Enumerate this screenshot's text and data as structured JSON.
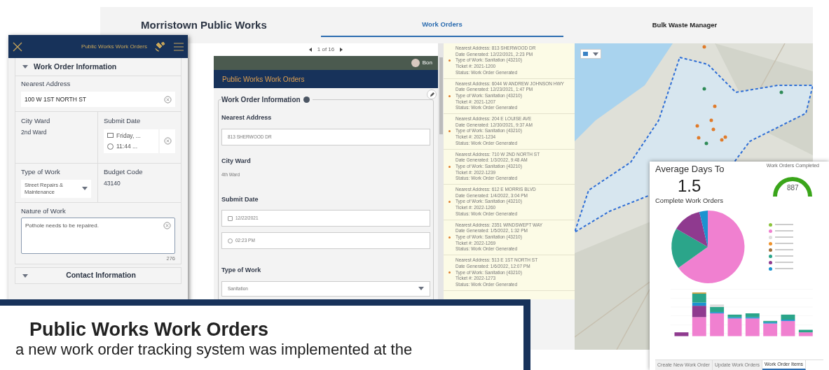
{
  "dashboard": {
    "title": "Morristown Public Works",
    "tabs": [
      {
        "label": "Work Orders",
        "selected": true
      },
      {
        "label": "Bulk Waste Manager",
        "selected": false
      }
    ]
  },
  "form_panel": {
    "pager": "1 of 16",
    "user": "Bon",
    "title": "Public Works Work Orders",
    "section": "Work Order Information",
    "fields": [
      {
        "kind": "input",
        "label": "Nearest Address",
        "values": [
          "813 SHERWOOD DR"
        ]
      },
      {
        "kind": "text",
        "label": "City Ward",
        "values": [
          "4th Ward"
        ]
      },
      {
        "kind": "date",
        "label": "Submit Date",
        "values": [
          "12/22/2021",
          "02:23 PM"
        ]
      },
      {
        "kind": "select",
        "label": "Type of Work",
        "values": [
          "Sanitation"
        ]
      }
    ]
  },
  "work_orders": [
    {
      "lines": [
        "Nearest Address: 813 SHERWOOD DR",
        "Date Generated: 12/22/2021, 2:23 PM",
        "Type of Work: Sanitation (43210)",
        "Ticket #: 2021-1200",
        "Status: Work Order Generated"
      ]
    },
    {
      "lines": [
        "Nearest Address: 6044 W ANDREW JOHNSON HWY",
        "Date Generated: 12/23/2021, 1:47 PM",
        "Type of Work: Sanitation (43210)",
        "Ticket #: 2021-1207",
        "Status: Work Order Generated"
      ]
    },
    {
      "lines": [
        "Nearest Address: 204 E LOUISE AVE",
        "Date Generated: 12/30/2021, 9:37 AM",
        "Type of Work: Sanitation (43210)",
        "Ticket #: 2021-1234",
        "Status: Work Order Generated"
      ]
    },
    {
      "lines": [
        "Nearest Address: 710 W 2ND NORTH ST",
        "Date Generated: 1/3/2022, 9:48 AM",
        "Type of Work: Sanitation (43210)",
        "Ticket #: 2022-1239",
        "Status: Work Order Generated"
      ]
    },
    {
      "lines": [
        "Nearest Address: 612 E MORRIS BLVD",
        "Date Generated: 1/4/2022, 3:04 PM",
        "Type of Work: Sanitation (43210)",
        "Ticket #: 2022-1260",
        "Status: Work Order Generated"
      ]
    },
    {
      "lines": [
        "Nearest Address: 2351 WINDSWEPT WAY",
        "Date Generated: 1/5/2022, 1:32 PM",
        "Type of Work: Sanitation (43210)",
        "Ticket #: 2022-1269",
        "Status: Work Order Generated"
      ]
    },
    {
      "lines": [
        "Nearest Address: 513 E 1ST NORTH ST",
        "Date Generated: 1/6/2022, 12:07 PM",
        "Type of Work: Sanitation (43210)",
        "Ticket #: 2022-1273",
        "Status: Work Order Generated"
      ]
    }
  ],
  "stats_panel": {
    "heading": "Average Days To",
    "value": "1.5",
    "subheading": "Complete Work Orders",
    "gauge": {
      "label": "Work Orders Completed",
      "value": "887"
    },
    "tabs": [
      {
        "label": "Create New Work Order",
        "selected": false
      },
      {
        "label": "Update Work Orders",
        "selected": false
      },
      {
        "label": "Work Order Items",
        "selected": true
      }
    ]
  },
  "mobile_form": {
    "title": "Public Works Work Orders",
    "section": "Work Order Information",
    "nearest_address": {
      "label": "Nearest Address",
      "value": "100 W 1ST NORTH ST"
    },
    "city_ward": {
      "label": "City Ward",
      "value": "2nd Ward"
    },
    "submit_date": {
      "label": "Submit Date",
      "date": "Friday, ...",
      "time": "11:44 ..."
    },
    "type_of_work": {
      "label": "Type of Work",
      "value": "Street Repairs & Maintenance"
    },
    "budget_code": {
      "label": "Budget Code",
      "value": "43140"
    },
    "nature_of_work": {
      "label": "Nature of Work",
      "value": "Pothole needs to be repaired.",
      "counter": "276"
    },
    "contact_section": "Contact Information"
  },
  "caption": {
    "title": "Public Works Work Orders",
    "text": "a new work order tracking system was implemented at the"
  }
}
